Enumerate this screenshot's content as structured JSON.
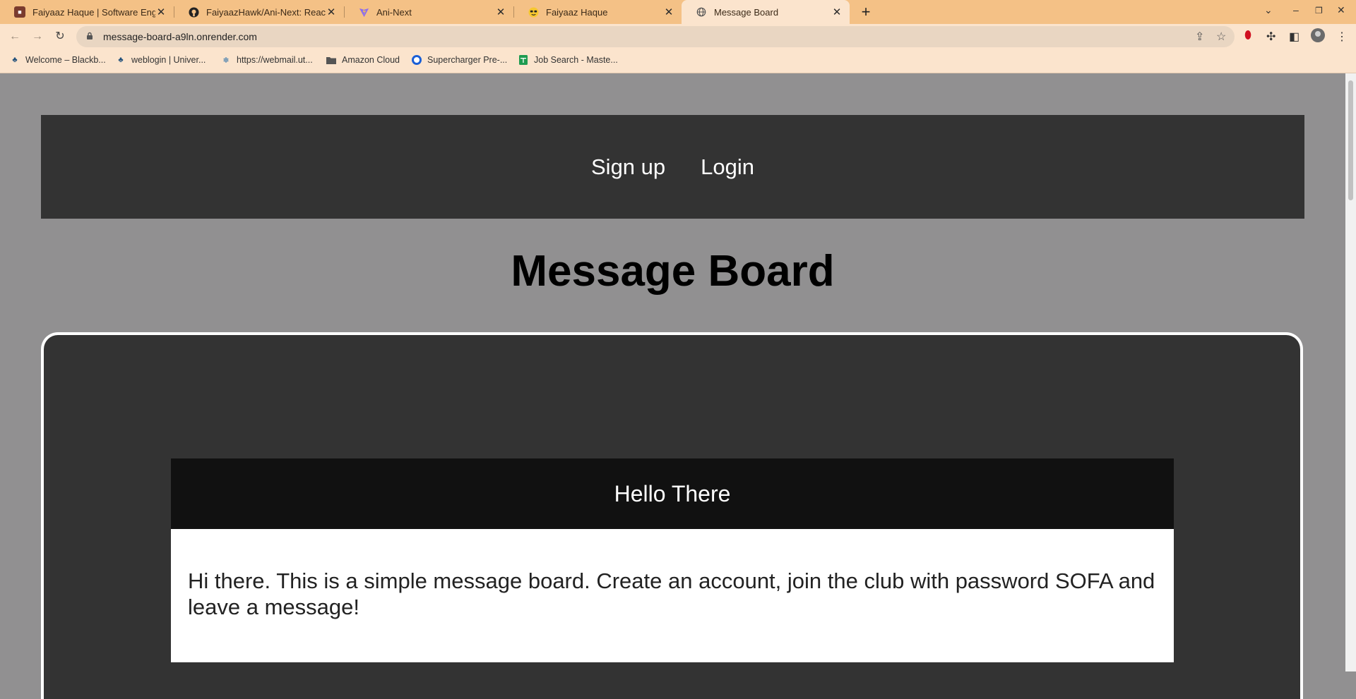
{
  "browser": {
    "tabs": [
      {
        "title": "Faiyaaz Haque | Software Engi",
        "icon": "profile-favicon"
      },
      {
        "title": "FaiyaazHawk/Ani-Next: React fr",
        "icon": "github-icon"
      },
      {
        "title": "Ani-Next",
        "icon": "vite-icon"
      },
      {
        "title": "Faiyaaz Haque",
        "icon": "emoji-sunglasses-icon"
      },
      {
        "title": "Message Board",
        "icon": "globe-icon",
        "active": true
      }
    ],
    "url": "message-board-a9ln.onrender.com",
    "bookmarks": [
      {
        "label": "Welcome – Blackb...",
        "icon": "tree-icon"
      },
      {
        "label": "weblogin | Univer...",
        "icon": "tree-icon"
      },
      {
        "label": "https://webmail.ut...",
        "icon": "snowflake-icon"
      },
      {
        "label": "Amazon Cloud",
        "icon": "folder-icon"
      },
      {
        "label": "Supercharger Pre-...",
        "icon": "circle-icon"
      },
      {
        "label": "Job Search - Maste...",
        "icon": "sheets-icon"
      }
    ],
    "accent_color": "#f4c186"
  },
  "header": {
    "links": [
      "Sign up",
      "Login"
    ]
  },
  "page_title": "Message Board",
  "messages": [
    {
      "title": "Hello There",
      "body": "Hi there. This is a simple message board. Create an account, join the club with password SOFA and leave a message!"
    }
  ]
}
